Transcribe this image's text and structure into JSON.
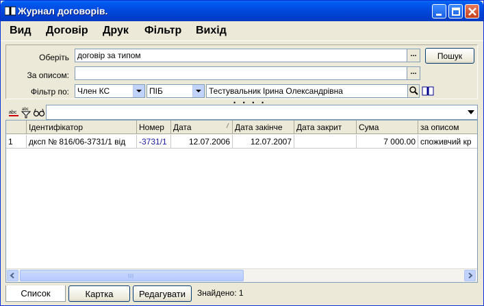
{
  "window": {
    "title": "Журнал договорів.",
    "icons": {
      "app": "book-icon",
      "minimize": "minimize-icon",
      "maximize": "maximize-icon",
      "close": "close-icon"
    }
  },
  "menu": [
    "Вид",
    "Договір",
    "Друк",
    "Фільтр",
    "Вихід"
  ],
  "form": {
    "select_label": "Оберіть",
    "select_value": "договір за типом",
    "desc_label": "За описом:",
    "desc_value": "",
    "filter_label": "Фільтр по:",
    "filter_field": "Член КС",
    "filter_attr": "ПІБ",
    "filter_value": "Тестувальник Ірина Олександрівна",
    "ellipsis": "...",
    "search_button": "Пошук"
  },
  "splitter": "• • • •",
  "table": {
    "columns": [
      "",
      "Ідентифікатор",
      "Номер",
      "Дата",
      "Дата закінче",
      "Дата закрит",
      "Сума",
      "за описом"
    ],
    "rows": [
      [
        "1",
        "дксп № 816/06-3731/1 від",
        "-3731/1",
        "12.07.2006",
        "12.07.2007",
        "",
        "7 000.00",
        "споживчий кр"
      ]
    ]
  },
  "bottom": {
    "tab_list": "Список",
    "tab_card": "Картка",
    "edit_button": "Редагувати",
    "status": "Знайдено: 1"
  },
  "colors": {
    "title_bar": "#0054e3",
    "link_number": "#1a1aa6"
  }
}
